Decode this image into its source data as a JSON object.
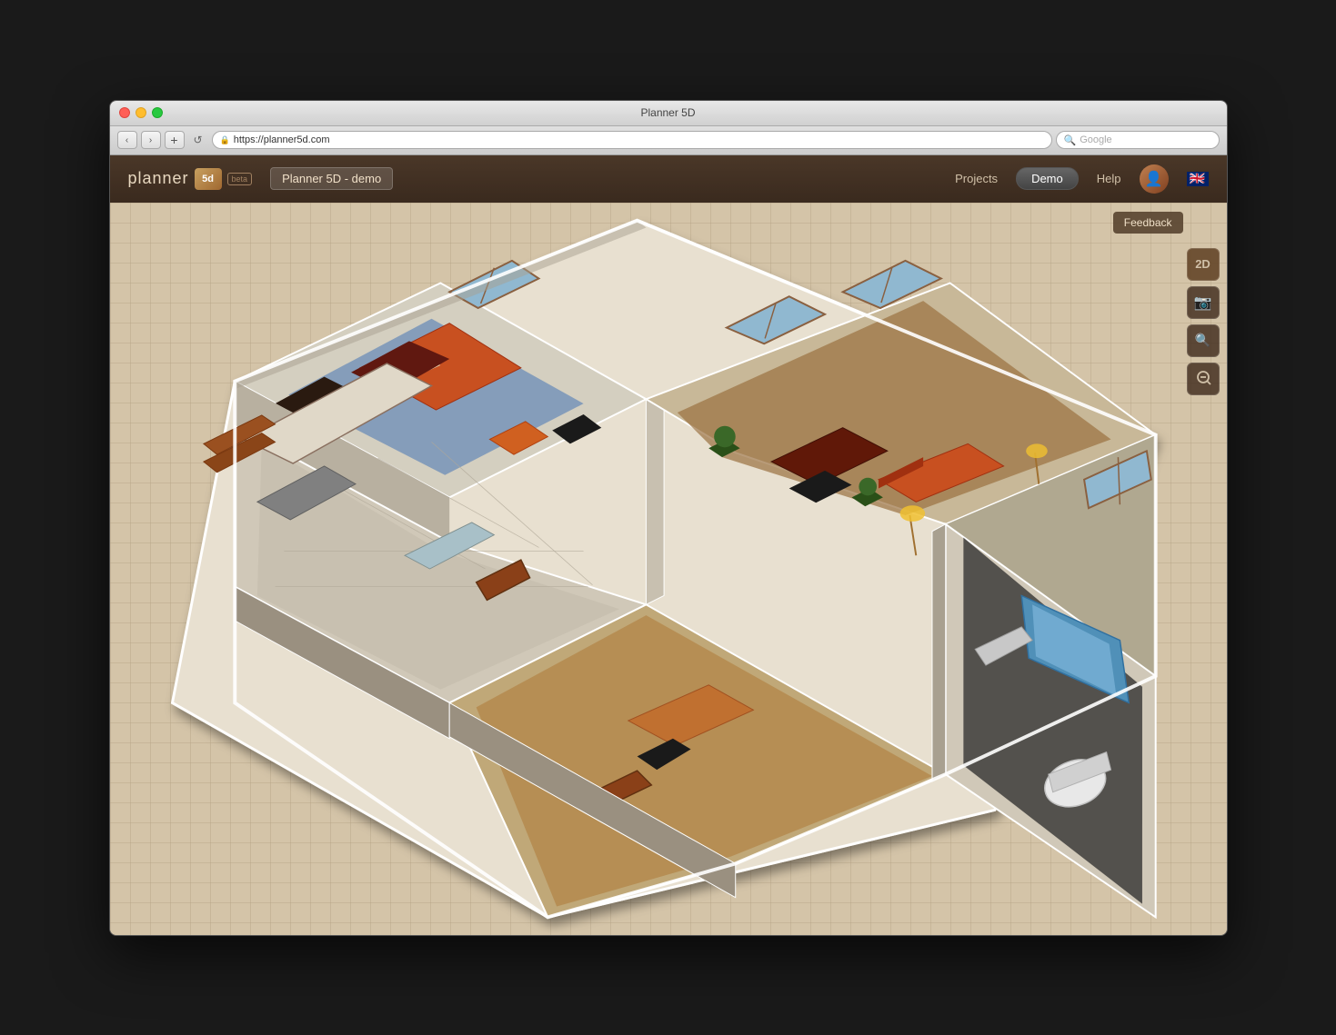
{
  "window": {
    "title": "Planner 5D",
    "traffic_lights": [
      "close",
      "minimize",
      "maximize"
    ]
  },
  "browser": {
    "back_label": "‹",
    "forward_label": "›",
    "refresh_label": "↺",
    "plus_label": "+",
    "url": "https://planner5d.com",
    "search_placeholder": "Google"
  },
  "header": {
    "logo_text": "planner",
    "logo_box": "5d",
    "beta_label": "beta",
    "project_name": "Planner 5D - demo",
    "nav_links": [
      "Projects",
      "Help"
    ],
    "demo_button": "Demo",
    "flag_emoji": "🇬🇧"
  },
  "toolbar": {
    "view_2d": "2D",
    "screenshot_icon": "📷",
    "zoom_in_icon": "🔍+",
    "zoom_out_icon": "🔍-",
    "feedback_label": "Feedback"
  },
  "floorplan": {
    "description": "3D isometric floor plan with multiple rooms",
    "rooms": [
      "bedroom with blue carpet and orange furniture",
      "living room with wood floor and orange sofa",
      "kitchen with tile floor",
      "office/study with wood floor",
      "bathroom with blue fixtures"
    ]
  }
}
